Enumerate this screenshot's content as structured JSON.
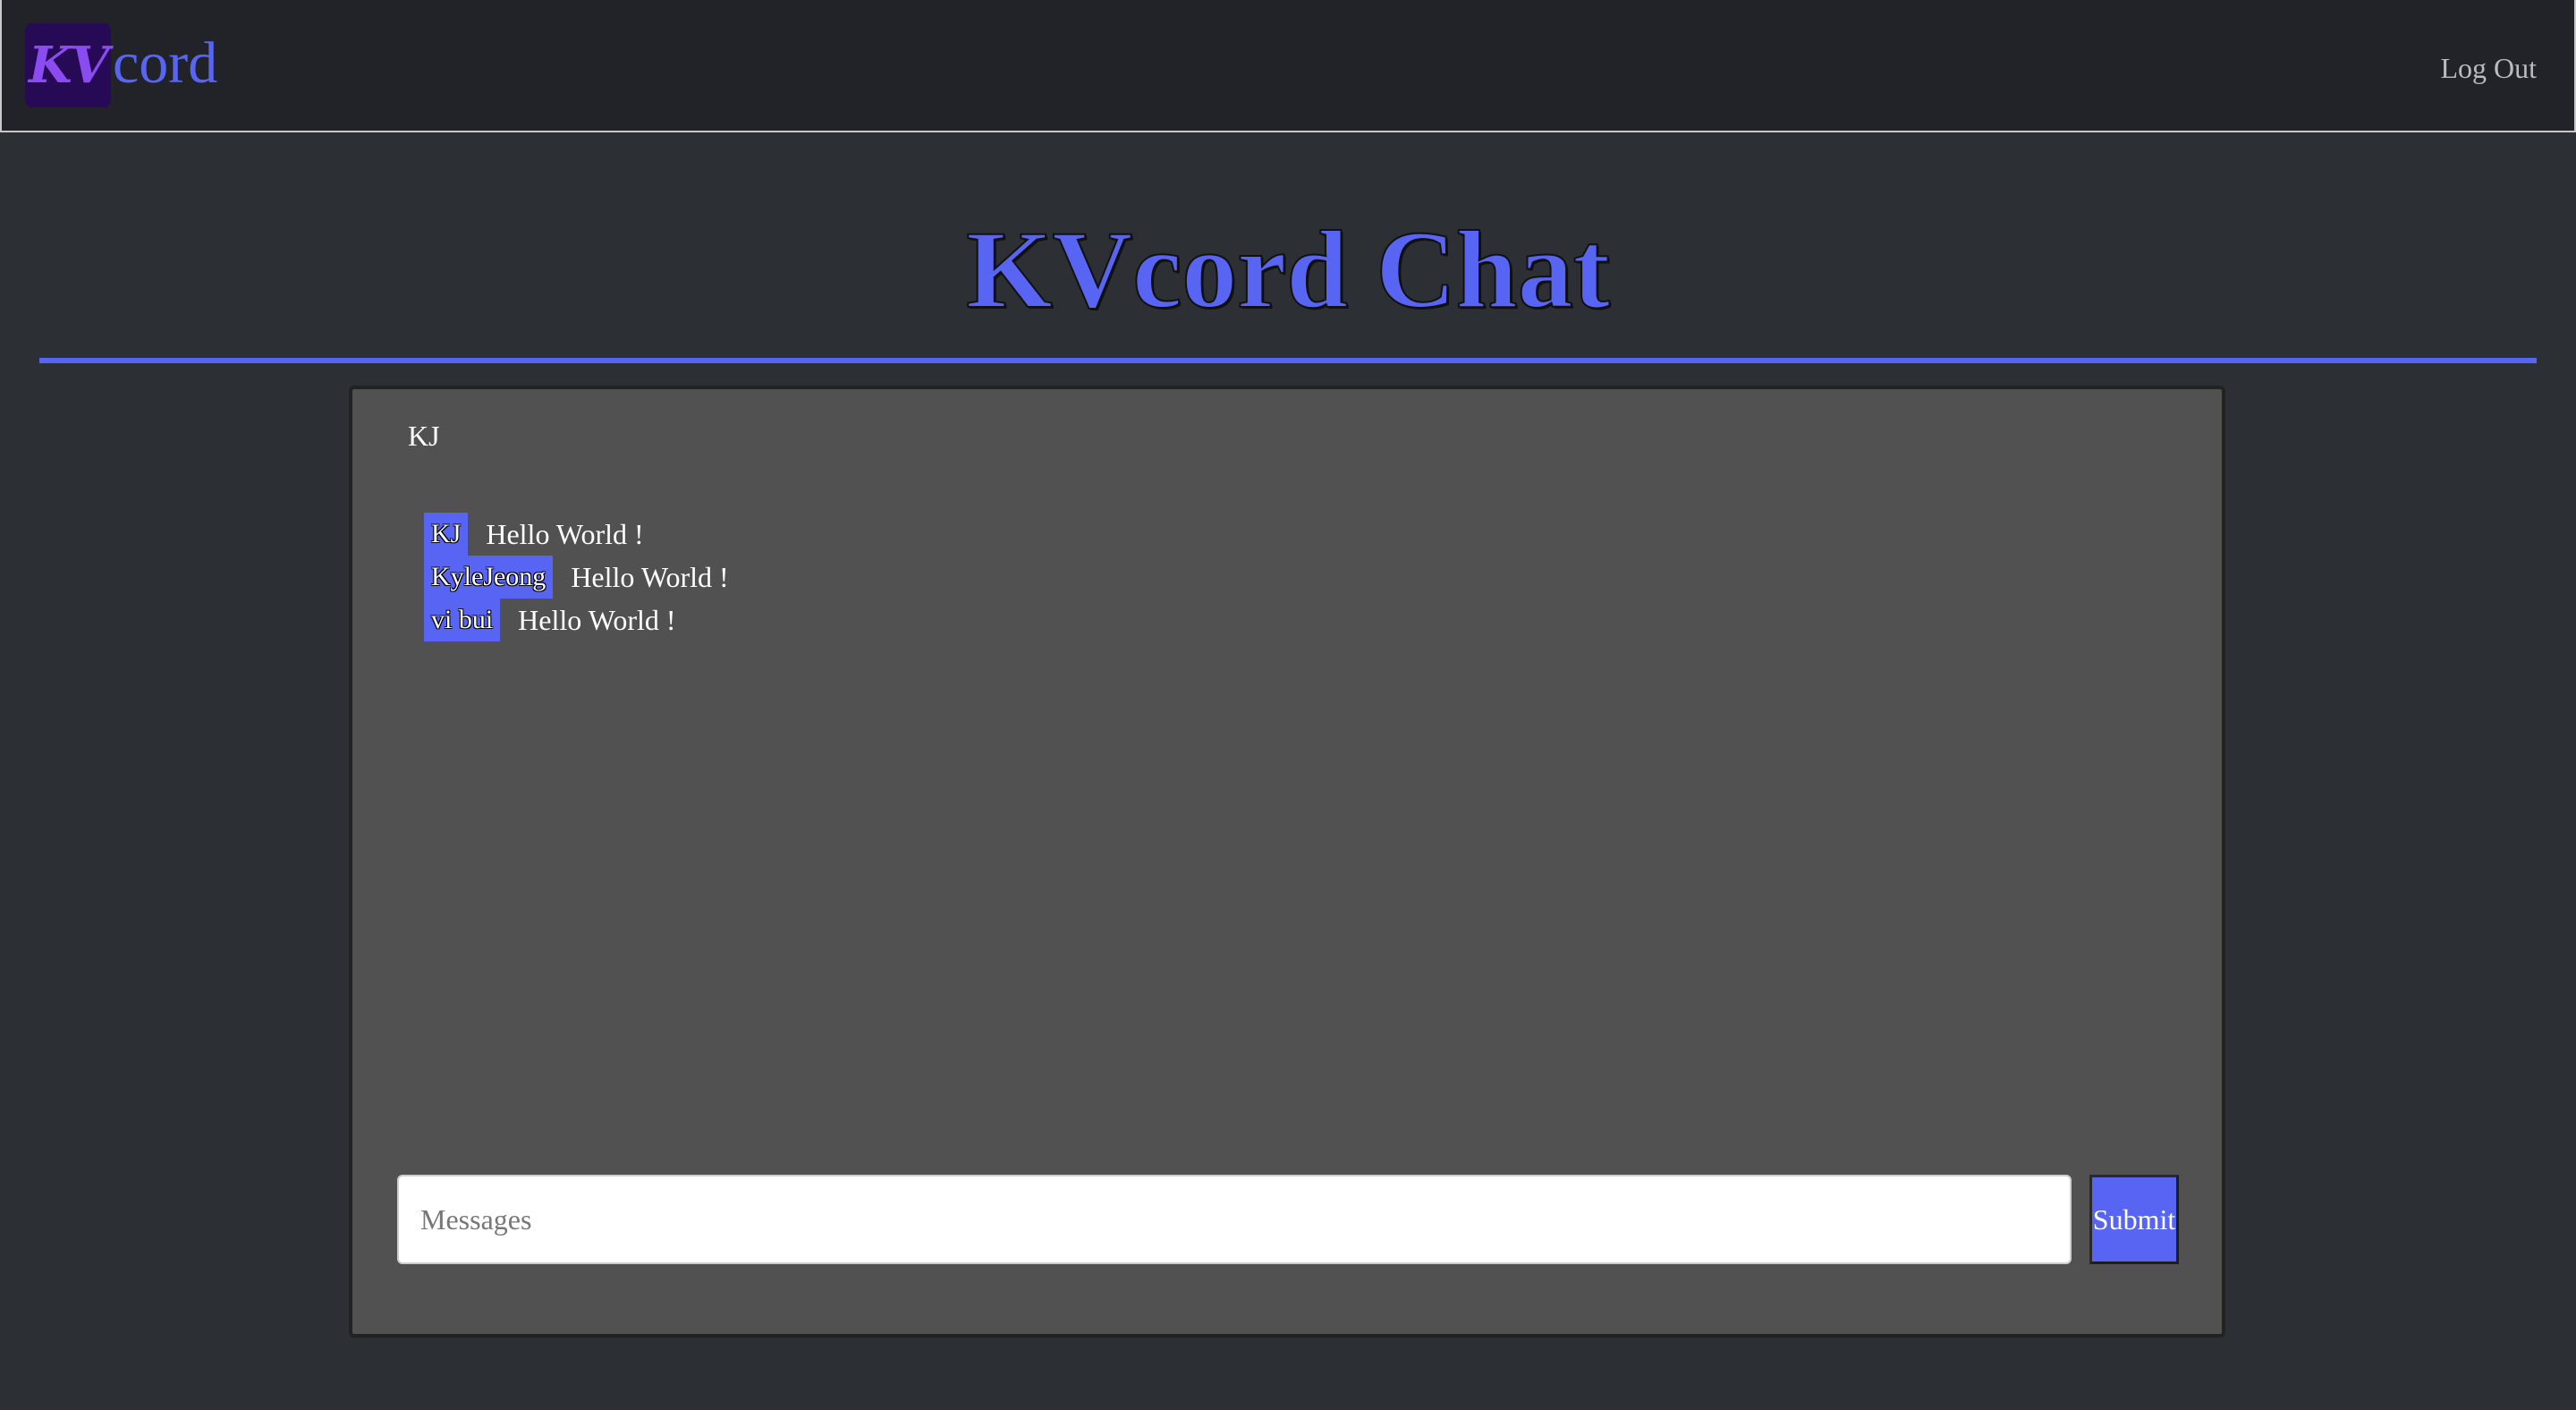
{
  "navbar": {
    "logo_text": "KV",
    "brand_text": "cord",
    "logout_label": "Log Out"
  },
  "page": {
    "title": "KVcord Chat"
  },
  "chat": {
    "room_name": "KJ",
    "messages": [
      {
        "user": "KJ",
        "text": "Hello World !"
      },
      {
        "user": "KyleJeong",
        "text": "Hello World !"
      },
      {
        "user": "vi bui",
        "text": "Hello World !"
      }
    ],
    "input": {
      "value": "",
      "placeholder": "Messages"
    },
    "submit_label": "Submit"
  },
  "colors": {
    "accent": "#5865f2",
    "background": "#2c2f33",
    "navbar": "#212329",
    "panel": "#515151",
    "logo_bg": "#260a55",
    "logo_fg": "#8a4cf0"
  }
}
